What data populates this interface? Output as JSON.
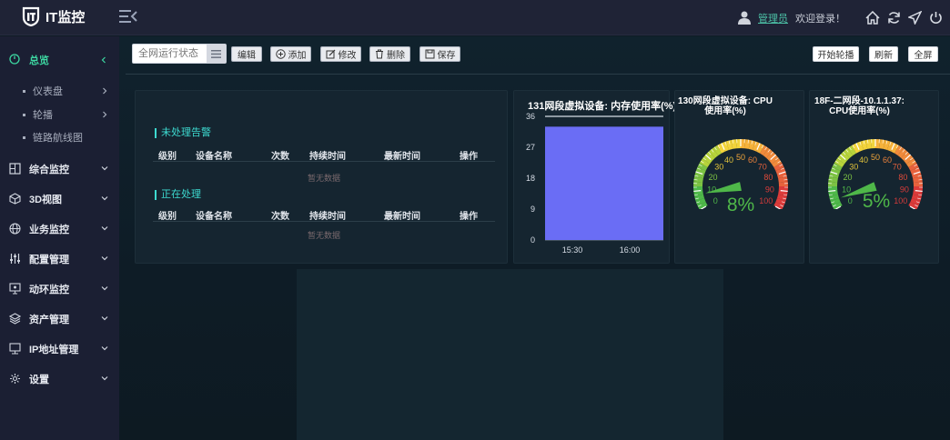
{
  "app": {
    "logo_text": "IT监控"
  },
  "header": {
    "user_name": "管理员",
    "welcome": "欢迎登录！"
  },
  "sidebar": {
    "overview": "总览",
    "sub_items": [
      {
        "label": "仪表盘"
      },
      {
        "label": "轮播"
      },
      {
        "label": "链路航线图"
      }
    ],
    "items": [
      {
        "label": "综合监控",
        "icon": "monitor-icon"
      },
      {
        "label": "3D视图",
        "icon": "cube-icon"
      },
      {
        "label": "业务监控",
        "icon": "globe-icon"
      },
      {
        "label": "配置管理",
        "icon": "sliders-icon"
      },
      {
        "label": "动环监控",
        "icon": "screen-icon"
      },
      {
        "label": "资产管理",
        "icon": "layers-icon"
      },
      {
        "label": "IP地址管理",
        "icon": "display-icon"
      },
      {
        "label": "设置",
        "icon": "gear-icon"
      }
    ]
  },
  "toolbar": {
    "search_placeholder": "全网运行状态",
    "edit": "编辑",
    "add": "添加",
    "modify": "修改",
    "delete": "删除",
    "save": "保存",
    "start_carousel": "开始轮播",
    "refresh": "刷新",
    "fullscreen": "全屏"
  },
  "alarms": {
    "unhandled_title": "未处理告警",
    "processing_title": "正在处理",
    "columns": [
      "级别",
      "设备名称",
      "次数",
      "持续时间",
      "最新时间",
      "操作"
    ],
    "no_data": "暂无数据"
  },
  "chart_data": {
    "type": "bar",
    "title": "131网段虚拟设备: 内存使用率(%)",
    "categories": [
      "15:30",
      "16:00"
    ],
    "values": [
      33
    ],
    "ylim": [
      0,
      36
    ],
    "yticks": [
      0,
      9,
      18,
      27,
      36
    ],
    "color": "#6a6df5"
  },
  "gauges": [
    {
      "title_line1": "130网段虚拟设备: CPU",
      "title_line2": "使用率(%)",
      "value": 8,
      "value_text": "8%",
      "ticks": [
        "0",
        "10",
        "20",
        "30",
        "40",
        "50",
        "60",
        "70",
        "80",
        "90",
        "100"
      ]
    },
    {
      "title_line1": "18F-二网段-10.1.1.37:",
      "title_line2": "CPU使用率(%)",
      "value": 5,
      "value_text": "5%",
      "ticks": [
        "0",
        "10",
        "20",
        "30",
        "40",
        "50",
        "60",
        "70",
        "80",
        "90",
        "100"
      ]
    }
  ],
  "colors": {
    "accent": "#3ddad0",
    "bar": "#6a6df5",
    "gauge_value": "#4fb849"
  }
}
